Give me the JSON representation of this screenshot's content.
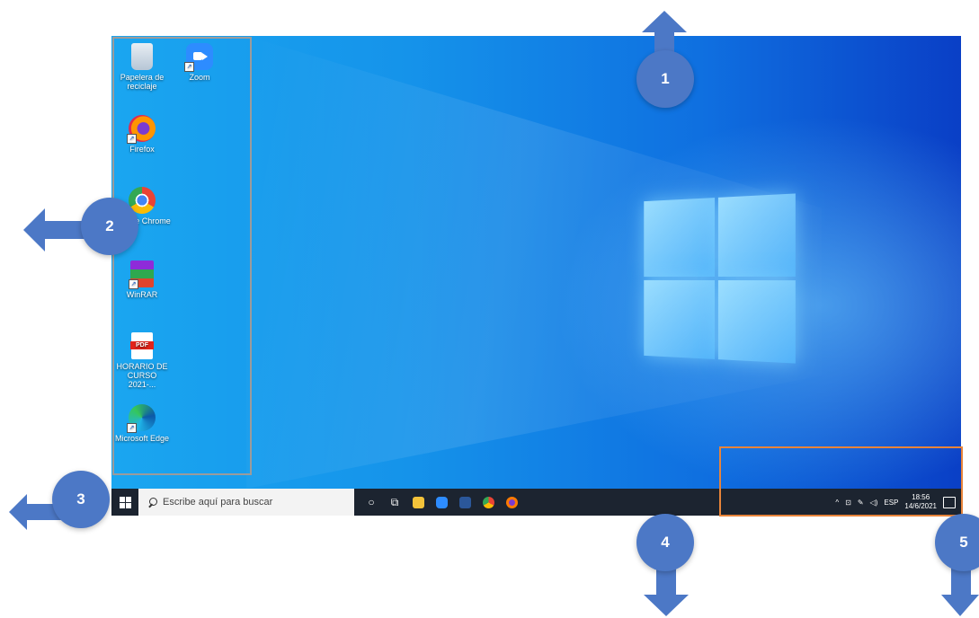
{
  "desktop": {
    "icons": [
      {
        "label": "Papelera de reciclaje",
        "icon": "recycle-bin-icon"
      },
      {
        "label": "Zoom",
        "icon": "zoom-icon"
      },
      {
        "label": "Firefox",
        "icon": "firefox-icon"
      },
      {
        "label": "Google Chrome",
        "icon": "chrome-icon"
      },
      {
        "label": "WinRAR",
        "icon": "winrar-icon"
      },
      {
        "label": "HORARIO DE CURSO 2021-...",
        "icon": "pdf-file-icon"
      },
      {
        "label": "Microsoft Edge",
        "icon": "edge-icon"
      }
    ]
  },
  "taskbar": {
    "search_placeholder": "Escribe aquí para buscar",
    "pinned": [
      "cortana-icon",
      "task-view-icon",
      "file-explorer-icon",
      "zoom-icon",
      "word-icon",
      "chrome-icon",
      "firefox-icon"
    ],
    "tray": {
      "language": "ESP",
      "time": "18:56",
      "date": "14/6/2021"
    }
  },
  "annotations": {
    "markers": [
      "1",
      "2",
      "3",
      "4",
      "5"
    ],
    "colors": {
      "marker": "#4c78c6",
      "box_left": "#9b9b9b",
      "box_right": "#e8843a"
    }
  },
  "pdf_badge": "PDF"
}
